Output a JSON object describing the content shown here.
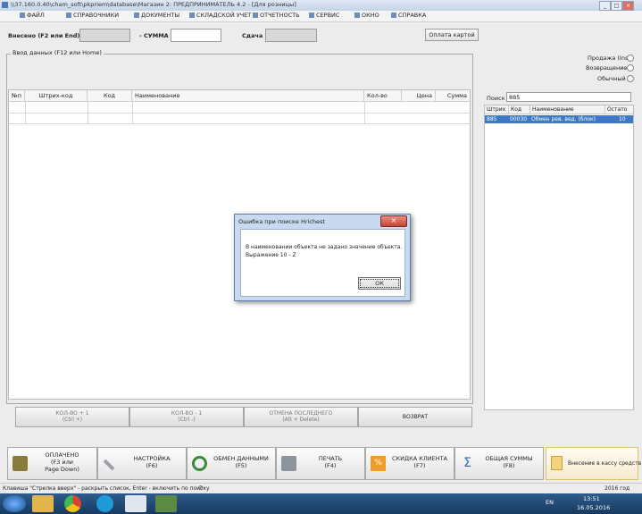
{
  "window": {
    "title": "\\\\37.160.0.40\\cham_soft\\pkpriem\\database\\Магазин 2: ПРЕДПРИНИМАТЕЛЬ 4.2 - [Для розницы]"
  },
  "menu": {
    "items": [
      "ФАЙЛ",
      "СПРАВОЧНИКИ",
      "ДОКУМЕНТЫ",
      "СКЛАДСКОЙ УЧЕТ",
      "ОТЧЕТНОСТЬ",
      "СЕРВИС",
      "ОКНО",
      "СПРАВКА"
    ]
  },
  "top": {
    "paid_label": "Внесено (F2 или End)",
    "sum_label": "- СУММА",
    "change_label": "Сдача",
    "card_button": "Оплата картой"
  },
  "group": {
    "legend": "Ввод данных (F12 или Home)"
  },
  "table": {
    "headers": [
      "№п",
      "Штрих-код",
      "Код",
      "Наименование",
      "Кол-во",
      "Цена",
      "Сумма"
    ]
  },
  "panel_buttons": [
    {
      "line1": "КОЛ-ВО + 1",
      "line2": "(Ctrl +)"
    },
    {
      "line1": "КОЛ-ВО - 1",
      "line2": "(Ctrl -)"
    },
    {
      "line1": "ОТМЕНА ПОСЛЕДНЕГО",
      "line2": "(Alt + Delete)"
    },
    {
      "line1": "ВОЗВРАТ",
      "line2": ""
    }
  ],
  "right": {
    "radio_labels": [
      "Продажа (Ins)",
      "Возвращение",
      "Обычный"
    ],
    "search_label": "Поиск",
    "search_value": "885",
    "grid_headers": [
      "Штрих",
      "Код",
      "Наименование",
      "Остато"
    ],
    "row": {
      "barcode": "885",
      "code": "00030",
      "name": "Обмен рев. вед. (блок)",
      "rest": "10"
    }
  },
  "dialog": {
    "title": "Ошибка при поиске Hrichest",
    "message1": "В наименовании объекта не задано значение объекта.",
    "message2": "Выражение 10 - Z",
    "ok": "ОК"
  },
  "fbuttons": [
    {
      "l1": "ОПЛАЧЕНО",
      "l2": "(F3 или",
      "l3": "Page Down)"
    },
    {
      "l1": "НАСТРОЙКА",
      "l2": "(F6)",
      "l3": ""
    },
    {
      "l1": "ОБМЕН ДАННЫМИ",
      "l2": "(F5)",
      "l3": ""
    },
    {
      "l1": "ПЕЧАТЬ",
      "l2": "(F4)",
      "l3": ""
    },
    {
      "l1": "СКИДКА КЛИЕНТА",
      "l2": "(F7)",
      "l3": ""
    },
    {
      "l1": "ОБЩАЯ СУММЫ",
      "l2": "(F8)",
      "l3": ""
    },
    {
      "l1": "Внесение в кассу средств",
      "l2": "",
      "l3": ""
    }
  ],
  "status": {
    "hint": "Клавиша \"Стрелка вверх\" - раскрыть список, Enter - включить по поиску",
    "year": "2016 год"
  },
  "taskbar": {
    "lang": "EN",
    "time": "13:51",
    "date": "16.05.2016"
  },
  "colors": {
    "accent": "#3f78c4",
    "taskbar": "#1f4570",
    "dialog_frame": "#c9daf0"
  }
}
